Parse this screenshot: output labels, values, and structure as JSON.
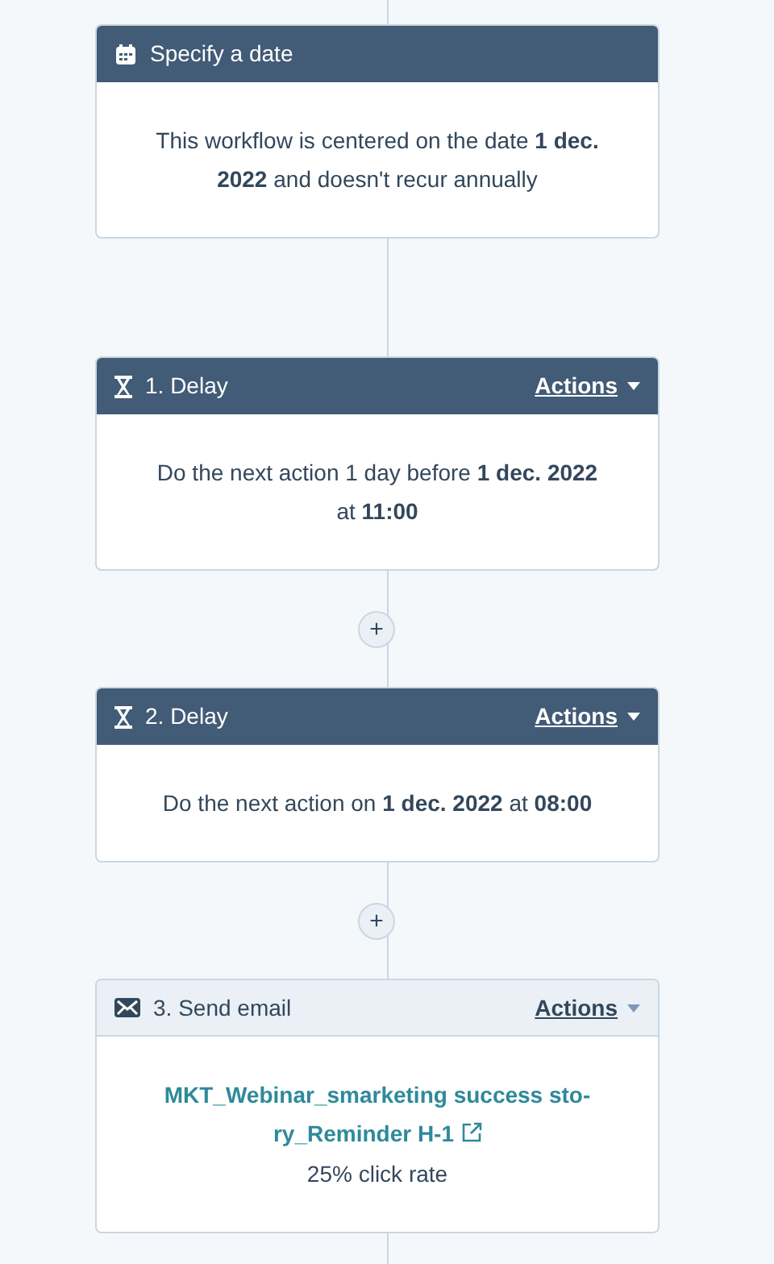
{
  "nodes": [
    {
      "kind": "date",
      "title": "Specify a date",
      "description": "This workflow is centered on the date **1 dec. 2022** and doesn't recur annually"
    },
    {
      "kind": "delay",
      "title": "1. Delay",
      "actions": "Actions",
      "description": "Do the next action 1 day before **1 dec. 2022** at **11:00**"
    },
    {
      "kind": "delay",
      "title": "2. Delay",
      "actions": "Actions",
      "add_button": "+",
      "description": "Do the next action on **1 dec. 2022** at **08:00**"
    },
    {
      "kind": "email",
      "title": "3. Send email",
      "actions": "Actions",
      "add_button": "+",
      "link_lines": [
        "MKT_Webinar_smarketing success sto-",
        "ry_Reminder H-1"
      ],
      "stat": "25% click rate"
    }
  ]
}
